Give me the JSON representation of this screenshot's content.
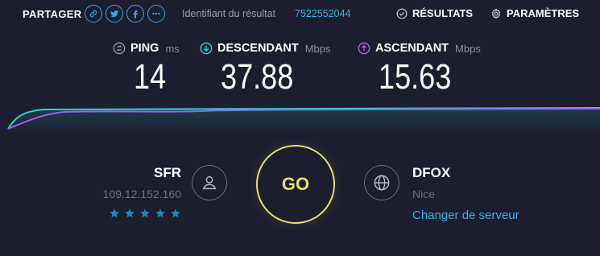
{
  "topbar": {
    "share_label": "PARTAGER",
    "share_icons": [
      "link-icon",
      "twitter-icon",
      "facebook-icon",
      "more-icon"
    ],
    "result_label": "Identifiant du résultat",
    "result_id": "7522552044",
    "results_label": "RÉSULTATS",
    "settings_label": "PARAMÈTRES"
  },
  "metrics": {
    "ping": {
      "label": "PING",
      "unit": "ms",
      "value": "14",
      "icon": "ping-icon",
      "color": "#9a9cb3"
    },
    "download": {
      "label": "DESCENDANT",
      "unit": "Mbps",
      "value": "37.88",
      "icon": "download-arrow-icon",
      "color": "#29d3d3"
    },
    "upload": {
      "label": "ASCENDANT",
      "unit": "Mbps",
      "value": "15.63",
      "icon": "upload-arrow-icon",
      "color": "#b05ee8"
    }
  },
  "isp": {
    "name": "SFR",
    "ip": "109.12.152.160",
    "rating": 5,
    "icon": "user-icon"
  },
  "go": {
    "label": "GO",
    "color": "#e6e06a"
  },
  "server": {
    "name": "DFOX",
    "location": "Nice",
    "change_label": "Changer de serveur",
    "icon": "globe-icon"
  },
  "colors": {
    "background": "#1c1d2f",
    "accent": "#3ab3e8",
    "download_line": "#29d3d3",
    "upload_line": "#b05ee8",
    "star": "#1f86b5"
  }
}
